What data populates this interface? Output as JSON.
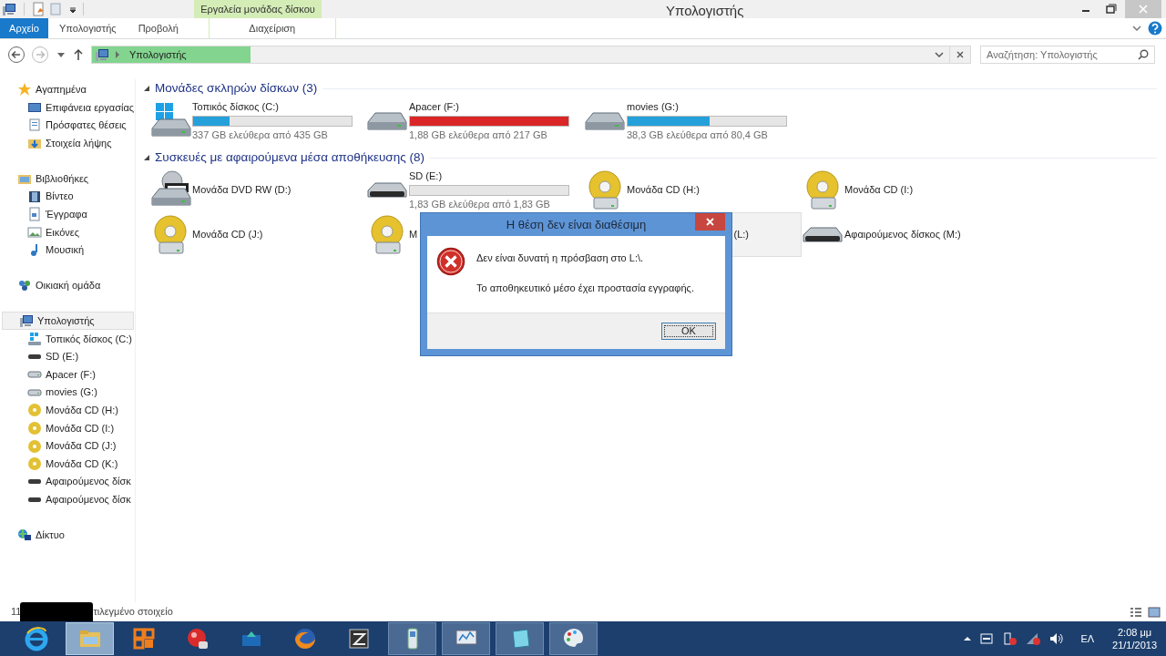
{
  "window": {
    "title": "Υπολογιστής"
  },
  "ribbon": {
    "contextual_group": "Εργαλεία μονάδας δίσκου",
    "tabs": [
      {
        "label": "Αρχείο",
        "kind": "file",
        "selected": false
      },
      {
        "label": "Υπολογιστής",
        "kind": "normal",
        "selected": false
      },
      {
        "label": "Προβολή",
        "kind": "normal",
        "selected": false
      },
      {
        "label": "Διαχείριση",
        "kind": "contextual",
        "selected": false
      }
    ]
  },
  "address_bar": {
    "crumb": "Υπολογιστής",
    "level": 0.18
  },
  "search": {
    "placeholder": "Αναζήτηση: Υπολογιστής"
  },
  "sidebar": {
    "groups": [
      {
        "label": "Αγαπημένα",
        "kind": "star",
        "selected": false,
        "children": [
          {
            "label": "Επιφάνεια εργασίας",
            "kind": "desktop"
          },
          {
            "label": "Πρόσφατες θέσεις",
            "kind": "recent"
          },
          {
            "label": "Στοιχεία λήψης",
            "kind": "downloads"
          }
        ]
      },
      {
        "label": "Βιβλιοθήκες",
        "kind": "libraries",
        "selected": false,
        "children": [
          {
            "label": "Βίντεο",
            "kind": "video"
          },
          {
            "label": "Έγγραφα",
            "kind": "documents"
          },
          {
            "label": "Εικόνες",
            "kind": "pictures"
          },
          {
            "label": "Μουσική",
            "kind": "music"
          }
        ]
      },
      {
        "label": "Οικιακή ομάδα",
        "kind": "homegroup",
        "selected": false
      },
      {
        "label": "Υπολογιστής",
        "kind": "computer",
        "selected": true,
        "children": [
          {
            "label": "Τοπικός δίσκος (C:)",
            "kind": "windows-drive"
          },
          {
            "label": "SD (E:)",
            "kind": "removable"
          },
          {
            "label": "Apacer (F:)",
            "kind": "hdd"
          },
          {
            "label": "movies (G:)",
            "kind": "hdd"
          },
          {
            "label": "Μονάδα CD (H:)",
            "kind": "cd"
          },
          {
            "label": "Μονάδα CD (I:)",
            "kind": "cd"
          },
          {
            "label": "Μονάδα CD (J:)",
            "kind": "cd"
          },
          {
            "label": "Μονάδα CD (K:)",
            "kind": "cd"
          },
          {
            "label": "Αφαιρούμενος δίσκ",
            "kind": "removable"
          },
          {
            "label": "Αφαιρούμενος δίσκ",
            "kind": "removable"
          }
        ]
      },
      {
        "label": "Δίκτυο",
        "kind": "network",
        "selected": false
      }
    ]
  },
  "sections": [
    {
      "title": "Μονάδες σκληρών δίσκων (3)",
      "items": [
        {
          "label": "Τοπικός δίσκος (C:)",
          "kind": "windows-drive",
          "level": 0.23,
          "color": "#26a0da",
          "space": "337 GB ελεύθερα από 435 GB",
          "selected": false,
          "partial": false
        },
        {
          "label": "Apacer (F:)",
          "kind": "hdd",
          "level": 1.0,
          "color": "#da2626",
          "space": "1,88 GB ελεύθερα από 217 GB",
          "selected": false,
          "partial": false
        },
        {
          "label": "movies (G:)",
          "kind": "hdd",
          "level": 0.52,
          "color": "#26a0da",
          "space": "38,3 GB ελεύθερα από 80,4 GB",
          "selected": false,
          "partial": false
        }
      ]
    },
    {
      "title": "Συσκευές με αφαιρούμενα μέσα αποθήκευσης (8)",
      "items": [
        {
          "label": "Μονάδα DVD RW (D:)",
          "kind": "dvd",
          "selected": false,
          "partial": false
        },
        {
          "label": "SD (E:)",
          "kind": "removable",
          "level": 0,
          "space": "1,83 GB ελεύθερα από 1,83 GB",
          "selected": false,
          "partial": false
        },
        {
          "label": "Μονάδα CD (H:)",
          "kind": "cd",
          "selected": false,
          "partial": false
        },
        {
          "label": "Μονάδα CD (I:)",
          "kind": "cd",
          "selected": false,
          "partial": false
        },
        {
          "label": "Μονάδα CD (J:)",
          "kind": "cd",
          "selected": false,
          "partial": false
        },
        {
          "label": "M",
          "kind": "cd",
          "selected": false,
          "partial": false
        },
        {
          "label": "(L:)",
          "kind": "none",
          "selected": true,
          "partial": true
        },
        {
          "label": "Αφαιρούμενος δίσκος (M:)",
          "kind": "removable",
          "selected": false,
          "partial": false
        }
      ]
    }
  ],
  "status_bar": {
    "count": "11",
    "text": "τιλεγμένο στοιχείο"
  },
  "dialog": {
    "title": "Η θέση δεν είναι διαθέσιμη",
    "message": "Δεν είναι δυνατή η πρόσβαση στο L:\\.",
    "detail": "Το αποθηκευτικό μέσο έχει προστασία εγγραφής.",
    "button": "OK"
  },
  "taskbar": {
    "apps": [
      {
        "kind": "browser-e",
        "selected": false,
        "running": false
      },
      {
        "kind": "folder",
        "selected": true,
        "running": true
      },
      {
        "kind": "office",
        "selected": false,
        "running": false
      },
      {
        "kind": "camera-ball",
        "selected": false,
        "running": false
      },
      {
        "kind": "box",
        "selected": false,
        "running": false
      },
      {
        "kind": "fox",
        "selected": false,
        "running": false
      },
      {
        "kind": "zip",
        "selected": false,
        "running": false
      },
      {
        "kind": "phone",
        "selected": false,
        "running": true
      },
      {
        "kind": "monitor",
        "selected": false,
        "running": true
      },
      {
        "kind": "notepad",
        "selected": false,
        "running": true
      },
      {
        "kind": "palette",
        "selected": false,
        "running": true
      }
    ],
    "language": "ΕΛ",
    "time": "2:08 μμ",
    "date": "21/1/2013"
  }
}
